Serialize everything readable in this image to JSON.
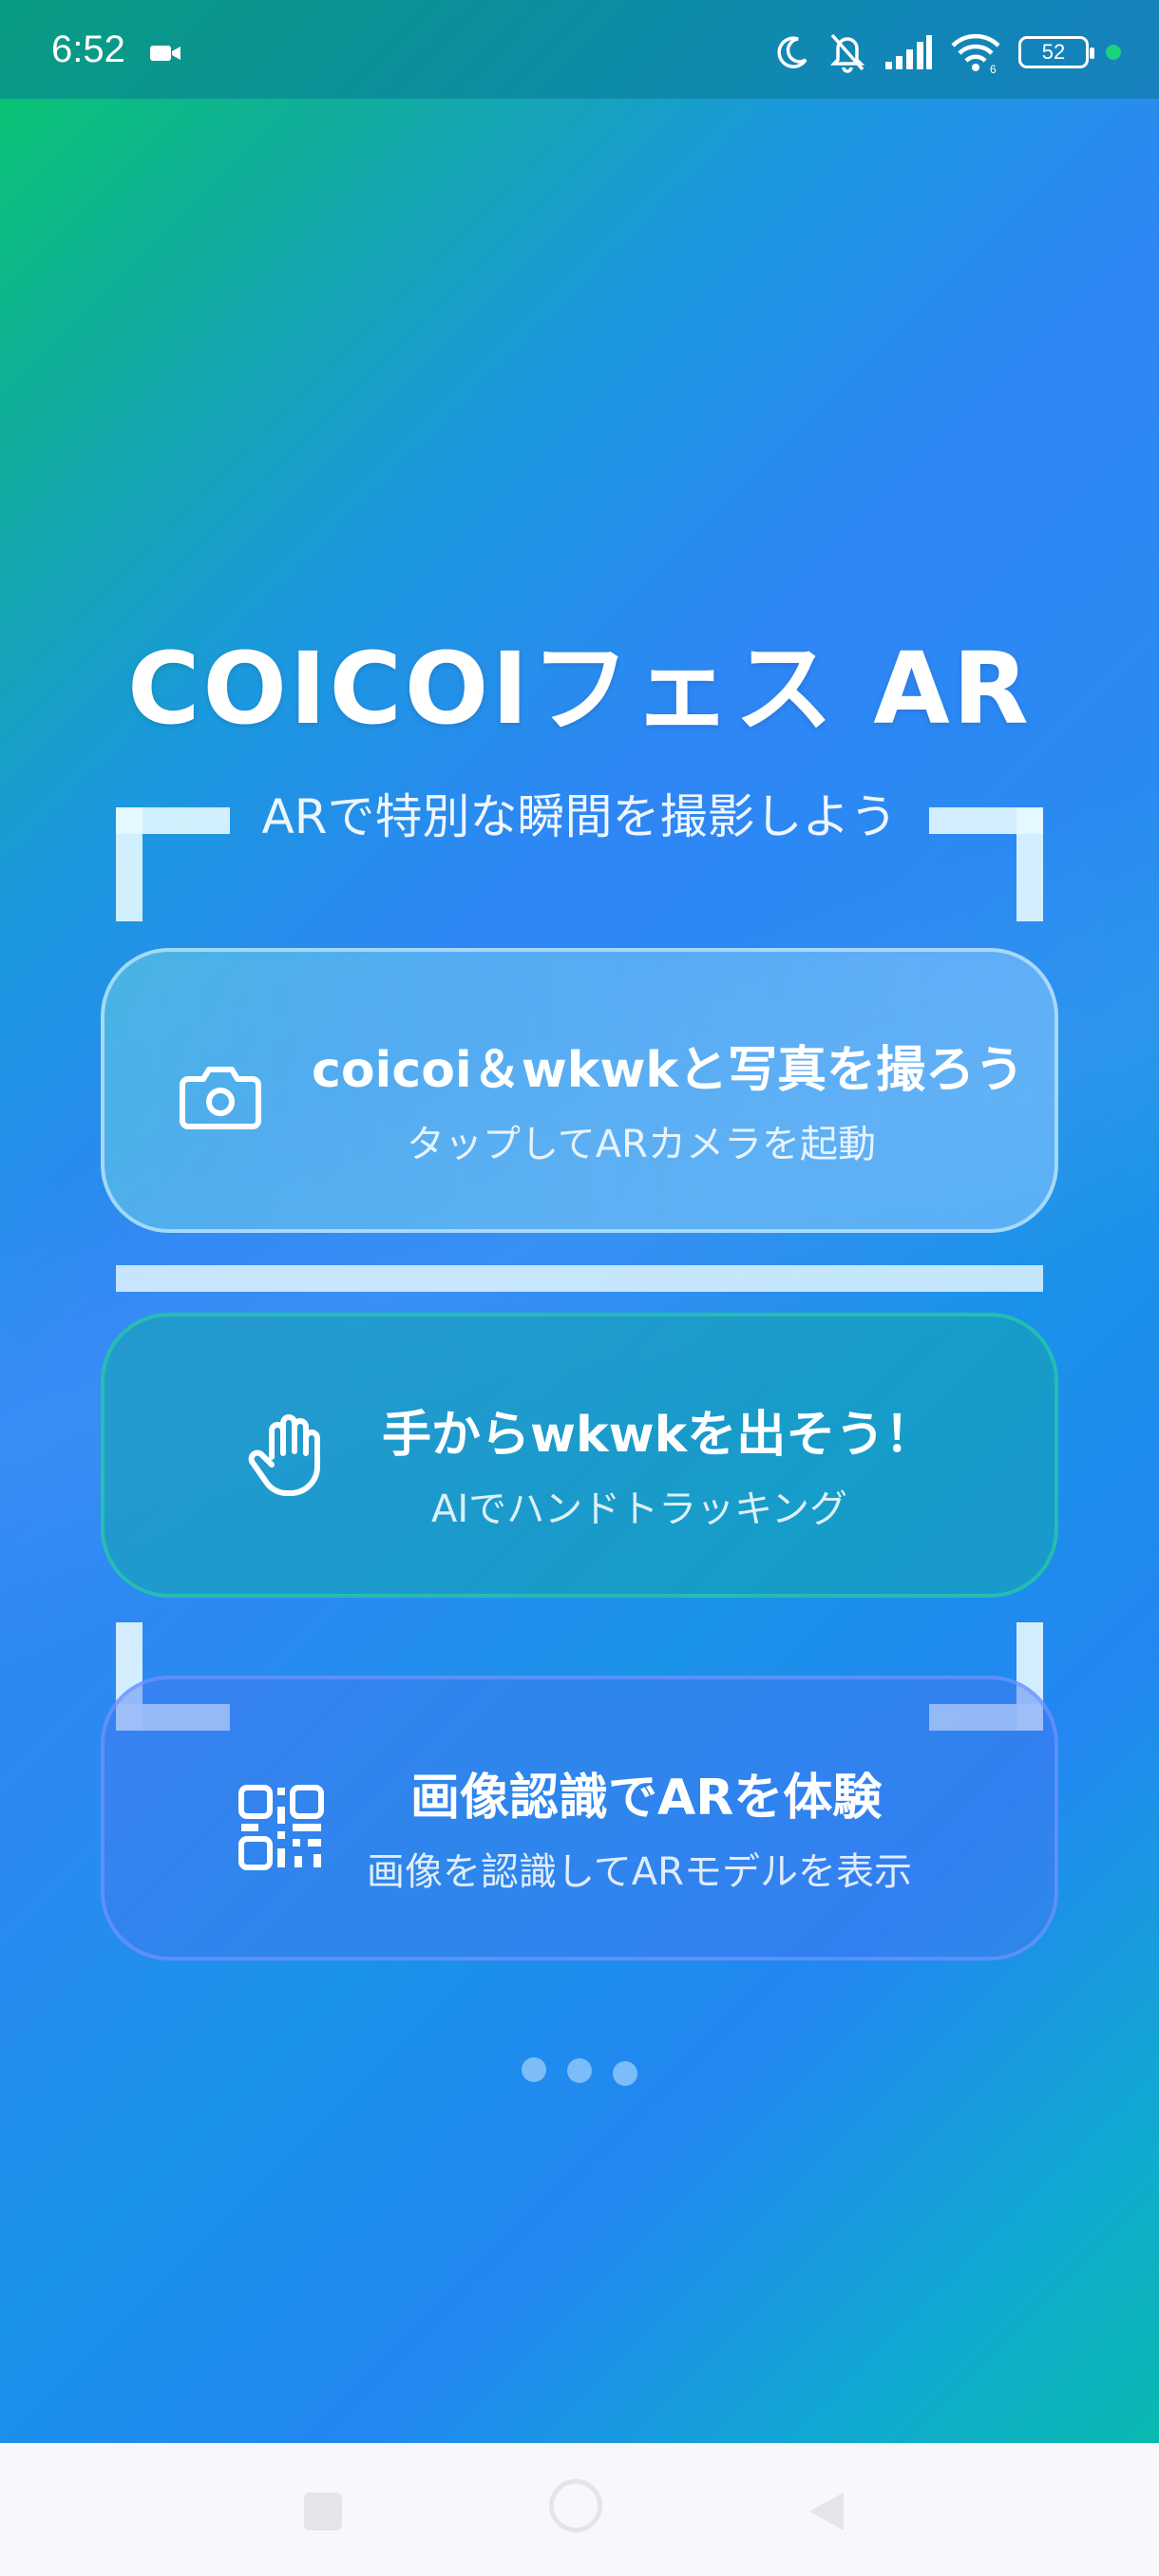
{
  "status_bar": {
    "time": "6:52",
    "battery_level": "52",
    "icons": [
      "video-camera-icon",
      "moon-icon",
      "bell-off-icon",
      "signal-icon",
      "wifi-icon",
      "battery-icon",
      "green-dot-icon"
    ]
  },
  "header": {
    "title": "COICOIフェス AR",
    "subtitle": "ARで特別な瞬間を撮影しよう"
  },
  "cards": [
    {
      "title": "coicoi＆wkwkと写真を撮ろう",
      "subtitle": "タップしてARカメラを起動",
      "icon": "camera-icon"
    },
    {
      "title": "手からwkwkを出そう！",
      "subtitle": "AIでハンドトラッキング",
      "icon": "hand-icon"
    },
    {
      "title": "画像認識でARを体験",
      "subtitle": "画像を認識してARモデルを表示",
      "icon": "qr-code-icon"
    }
  ],
  "pagination": {
    "count": 3
  },
  "navigation": {
    "buttons": [
      "recent-apps-button",
      "home-button",
      "back-button"
    ]
  },
  "colors": {
    "gradient_start": "#08c96a",
    "gradient_mid": "#2e86f5",
    "gradient_end": "#06bfa0",
    "accent_green_dot": "#19d47a"
  }
}
